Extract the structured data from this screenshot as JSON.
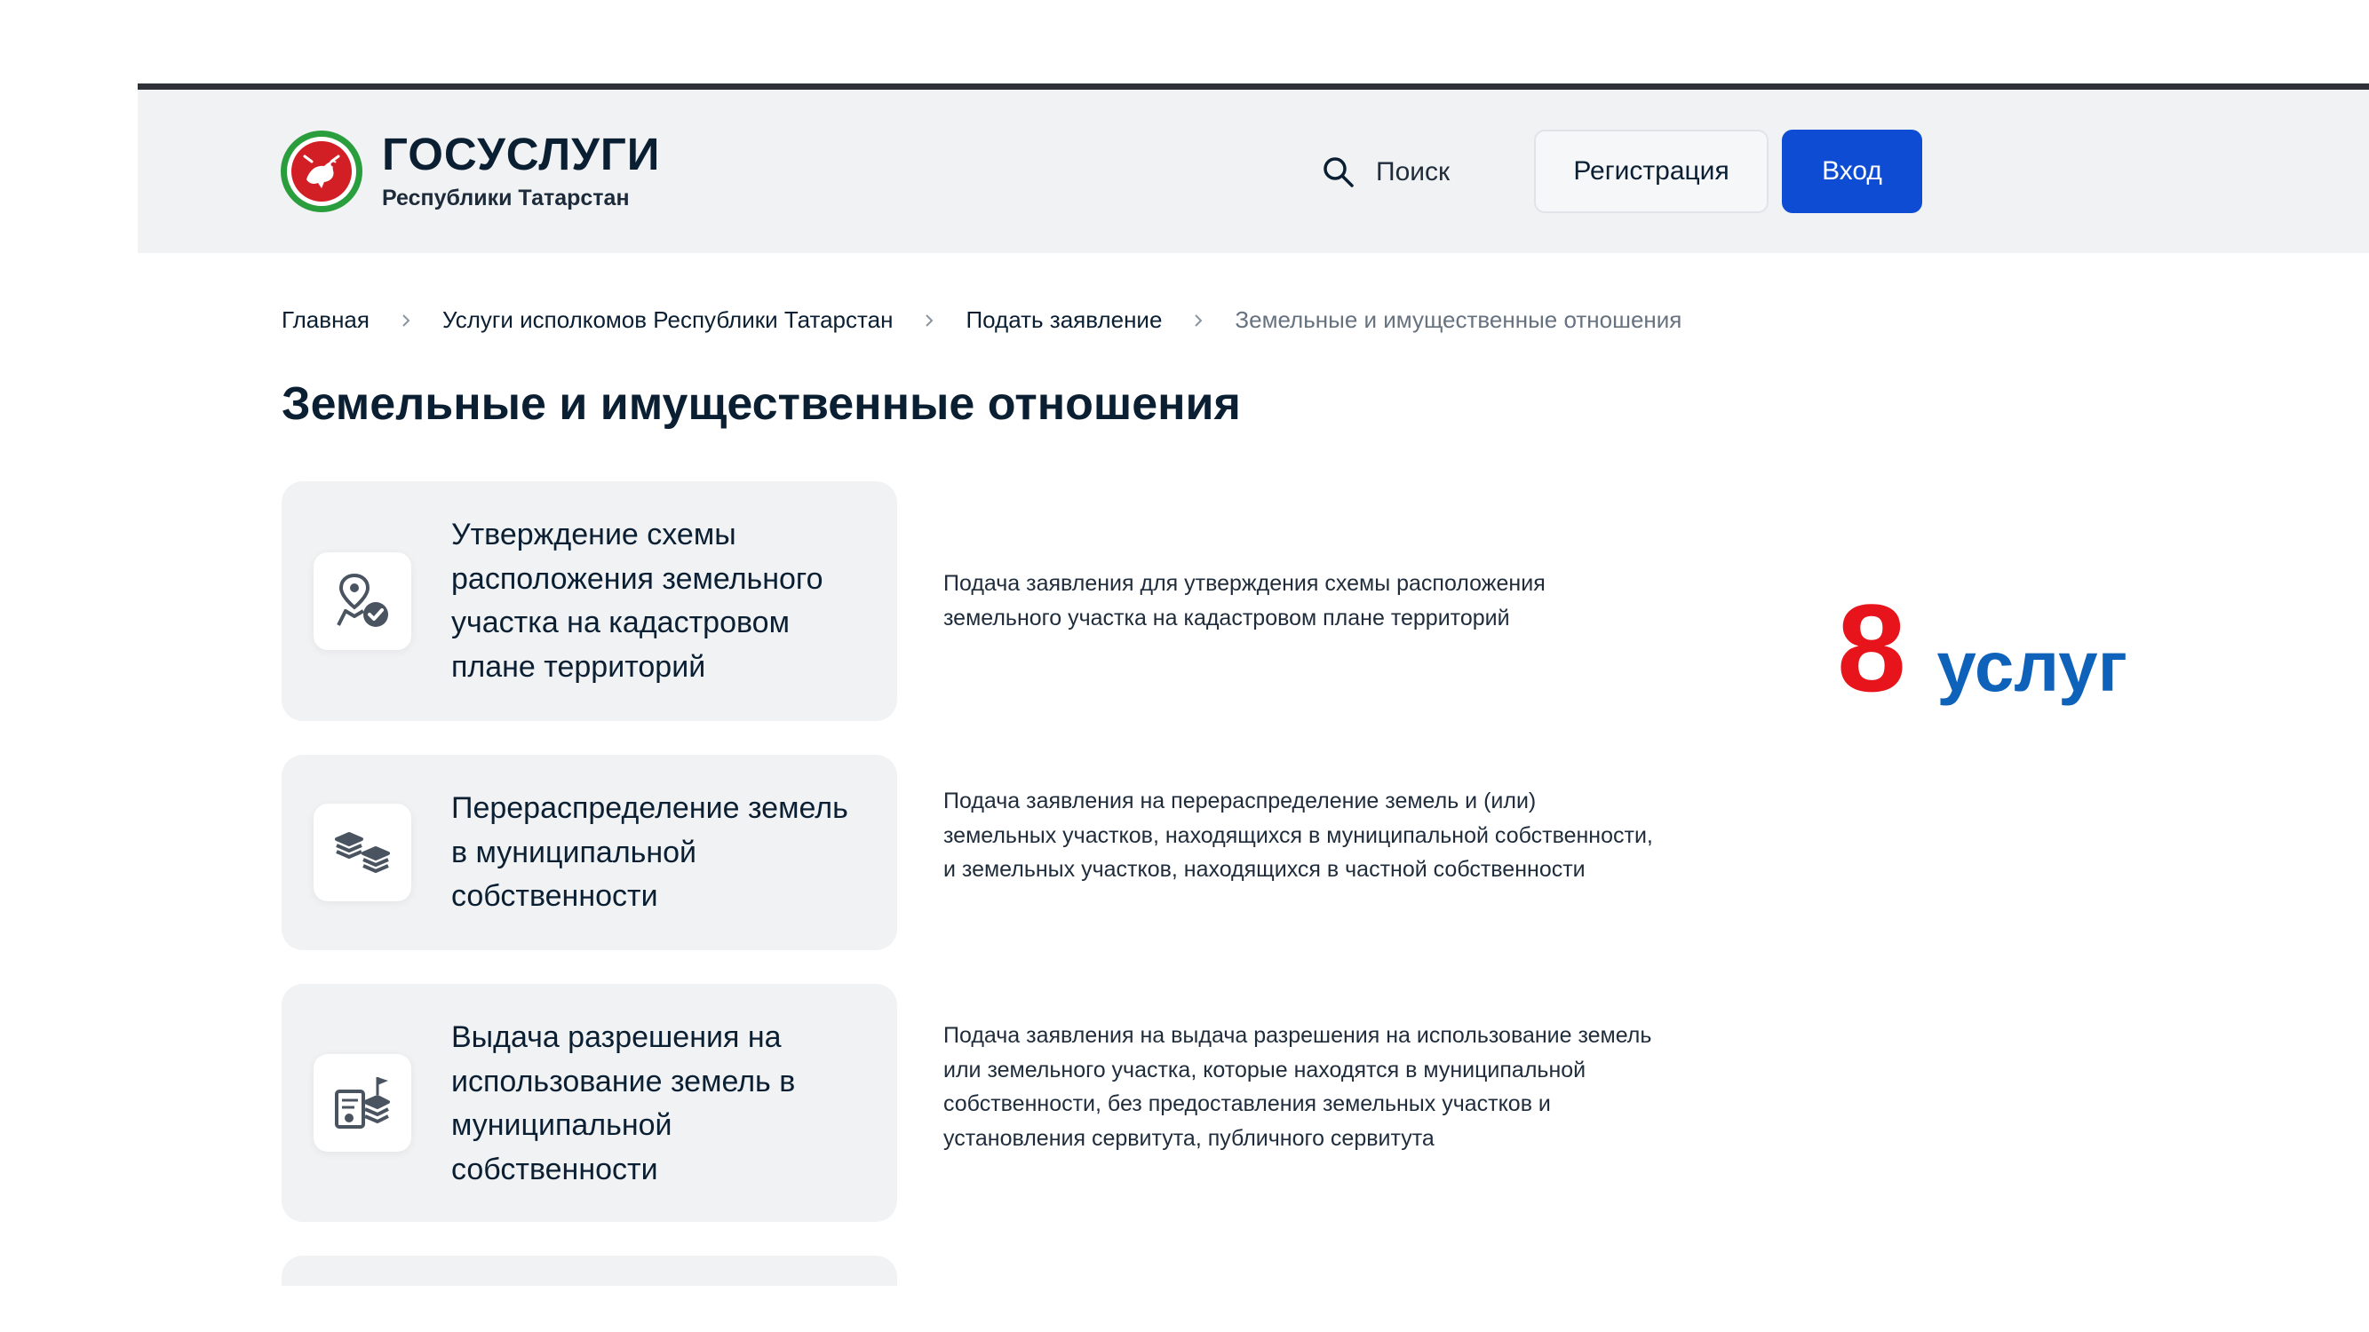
{
  "header": {
    "brand_name": "ГОСУСЛУГИ",
    "brand_sub": "Республики Татарстан",
    "search_label": "Поиск",
    "register_label": "Регистрация",
    "login_label": "Вход"
  },
  "breadcrumb": [
    "Главная",
    "Услуги исполкомов Республики Татарстан",
    "Подать заявление",
    "Земельные и имущественные отношения"
  ],
  "page_title": "Земельные и имущественные отношения",
  "services": [
    {
      "icon": "map-pin-check-icon",
      "title": "Утверждение схемы расположения земельного участка на кадастровом плане территорий",
      "description": "Подача заявления для утверждения схемы расположения земельного участка на кадастровом плане территорий"
    },
    {
      "icon": "land-layers-icon",
      "title": "Перераспределение земель в муниципальной собственности",
      "description": "Подача заявления на перераспределение земель и (или) земельных участков, находящихся в муниципальной собственности, и земельных участков, находящихся в частной собственности"
    },
    {
      "icon": "land-permit-icon",
      "title": "Выдача разрешения на использование земель в муниципальной собственности",
      "description": "Подача заявления на выдача разрешения на использование земель или земельного участка, которые находятся в муниципальной собственности, без предоставления земельных участков и установления сервитута, публичного сервитута"
    }
  ],
  "counter": {
    "number": "8",
    "word": "услуг"
  },
  "colors": {
    "accent_blue": "#0d4cd3",
    "counter_red": "#e8141c",
    "counter_blue": "#0f62b9",
    "logo_green": "#2a9d3c",
    "logo_red": "#d21f26"
  }
}
